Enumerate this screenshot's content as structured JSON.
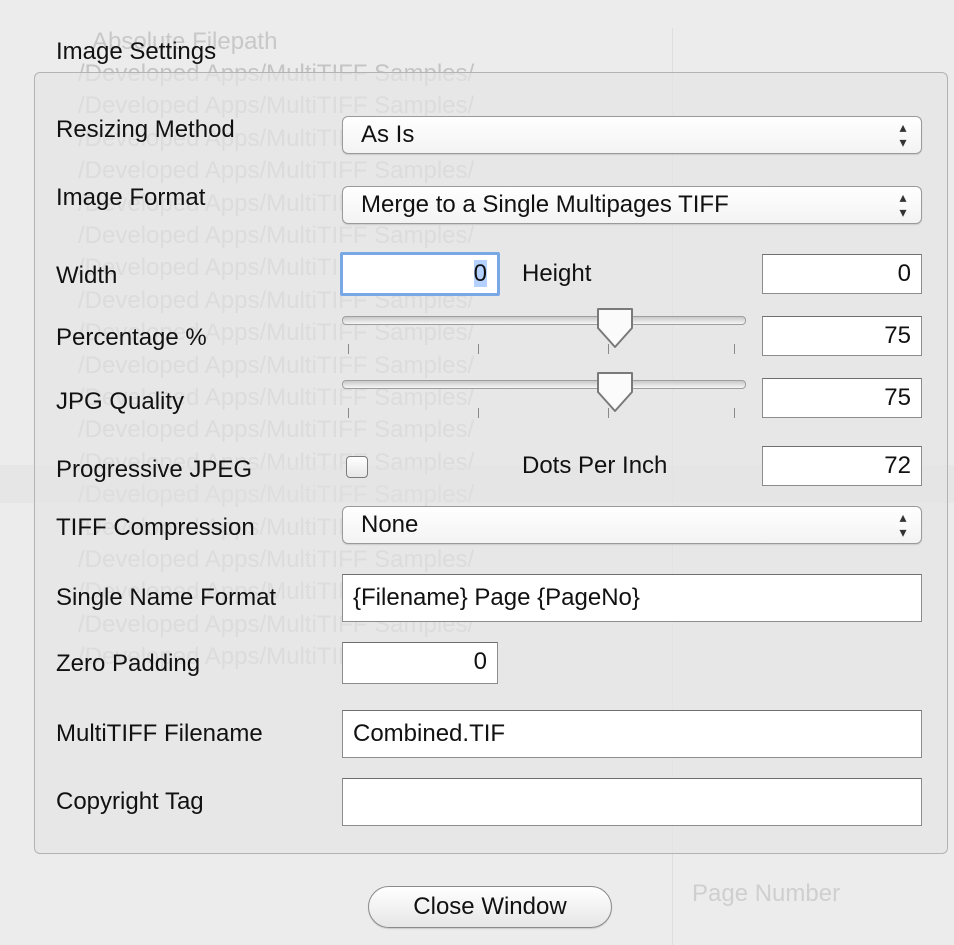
{
  "background": {
    "column_header": "Absolute Filepath",
    "path_rows": [
      "/Developed Apps/MultiTIFF Samples/",
      "/Developed Apps/MultiTIFF Samples/",
      "/Developed Apps/MultiTIFF Samples/",
      "/Developed Apps/MultiTIFF Samples/",
      "/Developed Apps/MultiTIFF Samples/",
      "/Developed Apps/MultiTIFF Samples/",
      "/Developed Apps/MultiTIFF Samples/",
      "/Developed Apps/MultiTIFF Samples/",
      "/Developed Apps/MultiTIFF Samples/",
      "/Developed Apps/MultiTIFF Samples/",
      "/Developed Apps/MultiTIFF Samples/",
      "/Developed Apps/MultiTIFF Samples/",
      "/Developed Apps/MultiTIFF Samples/",
      "/Developed Apps/MultiTIFF Samples/",
      "/Developed Apps/MultiTIFF Samples/",
      "/Developed Apps/MultiTIFF Samples/",
      "/Developed Apps/MultiTIFF Samples/",
      "/Developed Apps/MultiTIFF Samples/",
      "/Developed Apps/MultiTIFF Samples/"
    ],
    "page_number_header": "Page Number"
  },
  "panel": {
    "title": "Image Settings",
    "resizing_method": {
      "label": "Resizing Method",
      "value": "As Is"
    },
    "image_format": {
      "label": "Image Format",
      "value": "Merge to a Single Multipages TIFF"
    },
    "width": {
      "label": "Width",
      "value": "0"
    },
    "height": {
      "label": "Height",
      "value": "0"
    },
    "percentage": {
      "label": "Percentage %",
      "value": "75",
      "slider_fraction": 0.68
    },
    "jpg_quality": {
      "label": "JPG Quality",
      "value": "75",
      "slider_fraction": 0.68
    },
    "progressive_jpeg": {
      "label": "Progressive JPEG",
      "checked": false
    },
    "dots_per_inch": {
      "label": "Dots Per Inch",
      "value": "72"
    },
    "tiff_compression": {
      "label": "TIFF Compression",
      "value": "None"
    },
    "single_name_format": {
      "label": "Single Name Format",
      "value": "{Filename} Page {PageNo}"
    },
    "zero_padding": {
      "label": "Zero Padding",
      "value": "0"
    },
    "multitiff_filename": {
      "label": "MultiTIFF Filename",
      "value": "Combined.TIF"
    },
    "copyright_tag": {
      "label": "Copyright Tag",
      "value": ""
    }
  },
  "close_button": {
    "label": "Close Window"
  },
  "icons": {
    "popup_arrows": "up-down-chevron-icon",
    "slider_knob": "downward-pointer-knob-icon"
  }
}
